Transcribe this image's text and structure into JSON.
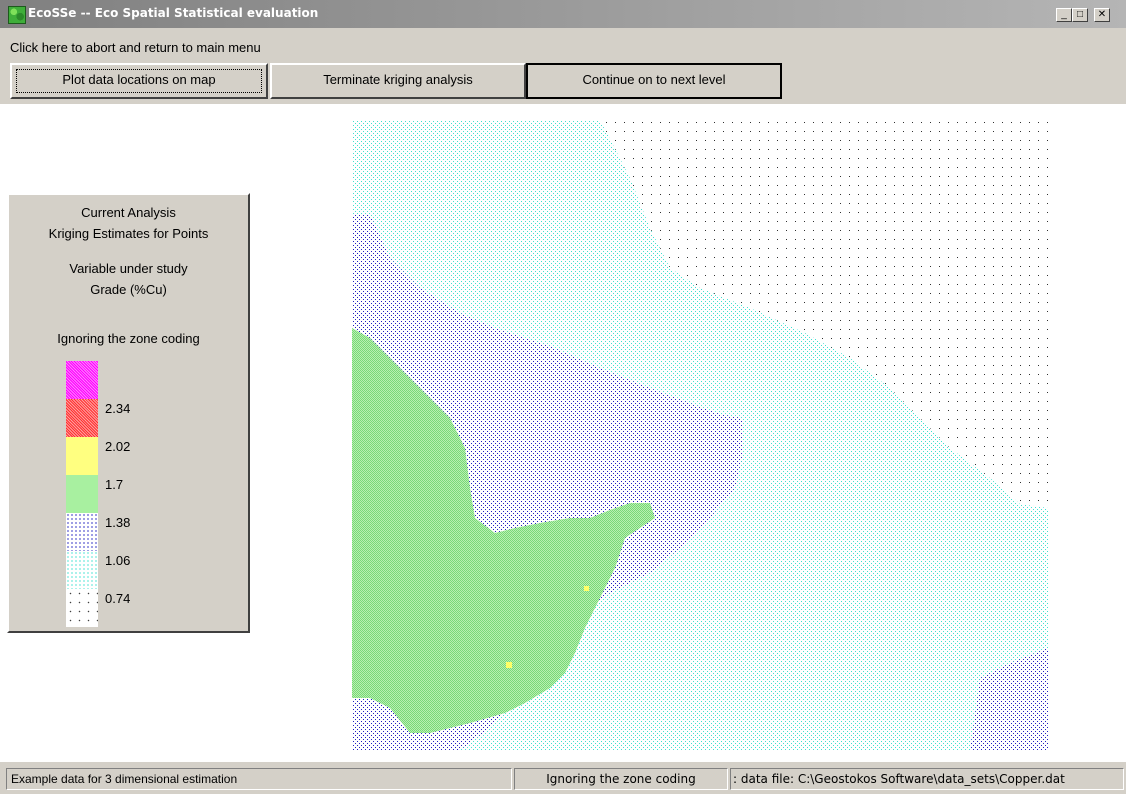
{
  "window": {
    "title": "EcoSSe -- Eco Spatial Statistical evaluation",
    "controls": {
      "minimize": "_",
      "maximize": "□",
      "close": "✕"
    }
  },
  "menu": {
    "abort_label": "Click here to abort and return to main menu"
  },
  "toolbar": {
    "plot_label": "Plot data locations on map",
    "terminate_label": "Terminate kriging analysis",
    "continue_label": "Continue on to next level"
  },
  "legend": {
    "analysis_heading": "Current Analysis",
    "analysis_name": "Kriging Estimates for Points",
    "variable_heading": "Variable under study",
    "variable_name": "Grade (%Cu)",
    "zone_note": "Ignoring the zone coding",
    "classes": [
      {
        "color": "#ff00ff",
        "label": ""
      },
      {
        "color": "#ff3030",
        "label": "2.34"
      },
      {
        "color": "#ffff66",
        "label": "2.02"
      },
      {
        "color": "#90ee90",
        "label": "1.7"
      },
      {
        "color": "#2020c0",
        "label": "1.38"
      },
      {
        "color": "#40e0d0",
        "label": "1.06"
      },
      {
        "color": "#404040",
        "label": "0.74"
      }
    ]
  },
  "status": {
    "dataset": "Example data for 3 dimensional estimation",
    "zone": "Ignoring the zone coding",
    "file": ": data file: C:\\Geostokos Software\\data_sets\\Copper.dat"
  }
}
